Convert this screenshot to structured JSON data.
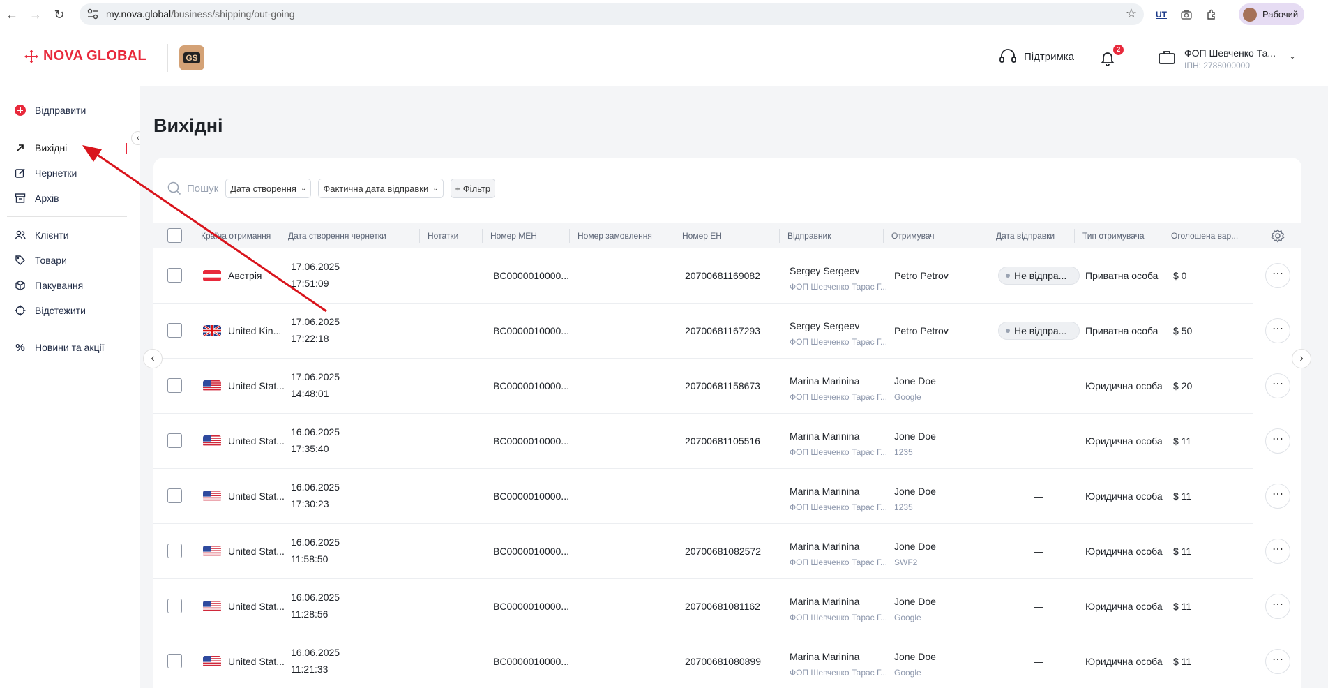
{
  "browser": {
    "url_host": "my.nova.global",
    "url_path": "/business/shipping/out-going",
    "profile_label": "Рабочий",
    "ext_label": "UT"
  },
  "header": {
    "logo_text": "NOVA GLOBAL",
    "gs_badge": "GS",
    "support_label": "Підтримка",
    "notifications_count": "2",
    "account_name": "ФОП Шевченко Та...",
    "account_tax": "ІПН: 2788000000"
  },
  "sidebar": {
    "send": "Відправити",
    "outgoing": "Вихідні",
    "drafts": "Чернетки",
    "archive": "Архів",
    "clients": "Клієнти",
    "goods": "Товари",
    "packaging": "Пакування",
    "track": "Відстежити",
    "news": "Новини та акції"
  },
  "page": {
    "title": "Вихідні",
    "search_placeholder": "Пошук",
    "filter_created": "Дата створення",
    "filter_actual": "Фактична дата відправки",
    "filter_add": "+ Фільтр"
  },
  "columns": {
    "country": "Країна отримання",
    "draft_date": "Дата створення чернетки",
    "notes": "Нотатки",
    "men": "Номер МЕН",
    "order": "Номер замовлення",
    "en": "Номер ЕН",
    "sender": "Відправник",
    "recipient": "Отримувач",
    "ship_date": "Дата відправки",
    "recipient_type": "Тип отримувача",
    "declared": "Оголошена вар..."
  },
  "rows": [
    {
      "flag": "at",
      "country": "Австрія",
      "date": "17.06.2025",
      "time": "17:51:09",
      "men": "BC0000010000...",
      "en": "20700681169082",
      "sender": "Sergey Sergeev",
      "sender_sub": "ФОП Шевченко Тарас Г...",
      "recipient": "Petro Petrov",
      "recipient_sub": "",
      "status": "Не відпра...",
      "ship_date": "",
      "rtype": "Приватна особа",
      "value": "$ 0"
    },
    {
      "flag": "gb",
      "country": "United Kin...",
      "date": "17.06.2025",
      "time": "17:22:18",
      "men": "BC0000010000...",
      "en": "20700681167293",
      "sender": "Sergey Sergeev",
      "sender_sub": "ФОП Шевченко Тарас Г...",
      "recipient": "Petro Petrov",
      "recipient_sub": "",
      "status": "Не відпра...",
      "ship_date": "",
      "rtype": "Приватна особа",
      "value": "$ 50"
    },
    {
      "flag": "us",
      "country": "United Stat...",
      "date": "17.06.2025",
      "time": "14:48:01",
      "men": "BC0000010000...",
      "en": "20700681158673",
      "sender": "Marina Marinina",
      "sender_sub": "ФОП Шевченко Тарас Г...",
      "recipient": "Jone Doe",
      "recipient_sub": "Google",
      "status": "",
      "ship_date": "—",
      "rtype": "Юридична особа",
      "value": "$ 20"
    },
    {
      "flag": "us",
      "country": "United Stat...",
      "date": "16.06.2025",
      "time": "17:35:40",
      "men": "BC0000010000...",
      "en": "20700681105516",
      "sender": "Marina Marinina",
      "sender_sub": "ФОП Шевченко Тарас Г...",
      "recipient": "Jone Doe",
      "recipient_sub": "1235",
      "status": "",
      "ship_date": "—",
      "rtype": "Юридична особа",
      "value": "$ 11"
    },
    {
      "flag": "us",
      "country": "United Stat...",
      "date": "16.06.2025",
      "time": "17:30:23",
      "men": "BC0000010000...",
      "en": "",
      "sender": "Marina Marinina",
      "sender_sub": "ФОП Шевченко Тарас Г...",
      "recipient": "Jone Doe",
      "recipient_sub": "1235",
      "status": "",
      "ship_date": "—",
      "rtype": "Юридична особа",
      "value": "$ 11"
    },
    {
      "flag": "us",
      "country": "United Stat...",
      "date": "16.06.2025",
      "time": "11:58:50",
      "men": "BC0000010000...",
      "en": "20700681082572",
      "sender": "Marina Marinina",
      "sender_sub": "ФОП Шевченко Тарас Г...",
      "recipient": "Jone Doe",
      "recipient_sub": "SWF2",
      "status": "",
      "ship_date": "—",
      "rtype": "Юридична особа",
      "value": "$ 11"
    },
    {
      "flag": "us",
      "country": "United Stat...",
      "date": "16.06.2025",
      "time": "11:28:56",
      "men": "BC0000010000...",
      "en": "20700681081162",
      "sender": "Marina Marinina",
      "sender_sub": "ФОП Шевченко Тарас Г...",
      "recipient": "Jone Doe",
      "recipient_sub": "Google",
      "status": "",
      "ship_date": "—",
      "rtype": "Юридична особа",
      "value": "$ 11"
    },
    {
      "flag": "us",
      "country": "United Stat...",
      "date": "16.06.2025",
      "time": "11:21:33",
      "men": "BC0000010000...",
      "en": "20700681080899",
      "sender": "Marina Marinina",
      "sender_sub": "ФОП Шевченко Тарас Г...",
      "recipient": "Jone Doe",
      "recipient_sub": "Google",
      "status": "",
      "ship_date": "—",
      "rtype": "Юридична особа",
      "value": "$ 11"
    }
  ],
  "colors": {
    "brand": "#e8293b",
    "annotation_arrow": "#d9141c"
  }
}
